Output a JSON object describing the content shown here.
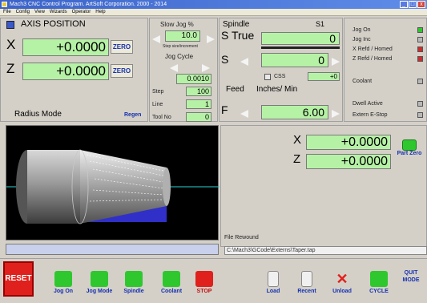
{
  "window": {
    "title": "Mach3 CNC Control Program. ArtSoft Corporation. 2000 - 2014",
    "minimize": "_",
    "maximize": "□",
    "close": "x"
  },
  "menu": [
    "File",
    "Config",
    "View",
    "Wizards",
    "Operator",
    "Help"
  ],
  "axis": {
    "title": "AXIS POSITION",
    "x_label": "X",
    "x_value": "+0.0000",
    "x_zero": "ZERO",
    "z_label": "Z",
    "z_value": "+0.0000",
    "z_zero": "ZERO",
    "mode": "Radius Mode",
    "regen": "Regen"
  },
  "jog": {
    "title": "Slow Jog %",
    "value": "10.0",
    "subtitle": "Step size/increment",
    "cycle_label": "Jog Cycle",
    "cycle_value": "0.0010",
    "step_label": "Step",
    "step_value": "100",
    "line_label": "Line",
    "line_value": "1",
    "tool_label": "Tool No",
    "tool_value": "0"
  },
  "spindle": {
    "title": "Spindle",
    "s1": "S1",
    "strue_label": "S True",
    "strue_value": "0",
    "s_label": "S",
    "s_value": "0",
    "css_label": "CSS",
    "css_value": "+0",
    "feed_label": "Feed",
    "feed_units": "Inches/ Min",
    "f_label": "F",
    "f_value": "6.00"
  },
  "status": {
    "items": [
      {
        "label": "Jog On",
        "color": "#2ec82e"
      },
      {
        "label": "Jog Inc",
        "color": "#b8b8b8"
      },
      {
        "label": "X Refd / Homed",
        "color": "#d22a2a"
      },
      {
        "label": "Z Refd / Homed",
        "color": "#d22a2a"
      }
    ],
    "coolant": "Coolant",
    "dwell": "Dwell Active",
    "estop": "Extern E-Stop"
  },
  "offsets": {
    "x_label": "X",
    "x_value": "+0.0000",
    "z_label": "Z",
    "z_value": "+0.0000",
    "part_zero": "Part Zero"
  },
  "file": {
    "status": "File Rewound",
    "path": "C:\\Mach3\\GCode\\Externs\\Taper.tap"
  },
  "toolbar": {
    "reset": "RESET",
    "jog_on": "Jog On",
    "jog_mode": "Jog Mode",
    "spindle": "Spindle",
    "coolant": "Coolant",
    "stop": "STOP",
    "load": "Load",
    "recent": "Recent",
    "unload": "Unload",
    "cycle": "CYCLE",
    "quit": "QUIT MODE"
  },
  "colors": {
    "dro_bg": "#b6f2a6",
    "reset_red": "#e0201c",
    "title_blue": "#3b63c9",
    "viewport": "#000000"
  }
}
